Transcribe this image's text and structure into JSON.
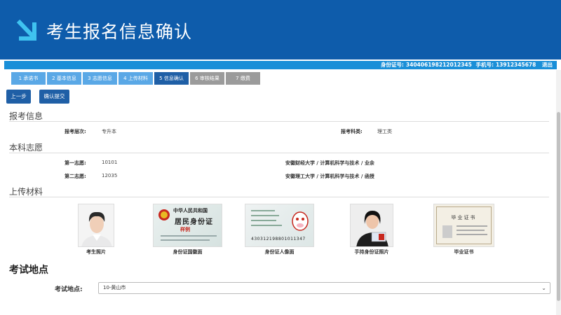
{
  "banner": {
    "title": "考生报名信息确认"
  },
  "infobar": {
    "id_label": "身份证号:",
    "id_value": "340406198212012345",
    "phone_label": "手机号:",
    "phone_value": "13912345678",
    "logout": "退出"
  },
  "steps": [
    {
      "label": "1 承诺书",
      "state": "done"
    },
    {
      "label": "2 基本信息",
      "state": "done"
    },
    {
      "label": "3 志愿信息",
      "state": "done"
    },
    {
      "label": "4 上传材料",
      "state": "done"
    },
    {
      "label": "5 信息确认",
      "state": "active"
    },
    {
      "label": "6 审核结果",
      "state": "todo"
    },
    {
      "label": "7 缴费",
      "state": "todo"
    }
  ],
  "buttons": {
    "prev": "上一步",
    "submit": "确认提交"
  },
  "exam_info": {
    "title": "报考信息",
    "level_label": "报考层次:",
    "level_value": "专升本",
    "subject_label": "报考科类:",
    "subject_value": "理工类"
  },
  "wishes": {
    "title": "本科志愿",
    "rows": [
      {
        "label": "第一志愿:",
        "code": "10101",
        "school": "安徽财经大学 / 计算机科学与技术 / 业余"
      },
      {
        "label": "第二志愿:",
        "code": "12035",
        "school": "安徽理工大学 / 计算机科学与技术 / 函授"
      }
    ]
  },
  "materials": {
    "title": "上传材料",
    "items": [
      {
        "caption": "考生照片"
      },
      {
        "caption": "身份证国徽面",
        "card_header": "中华人民共和国",
        "card_title": "居民身份证",
        "stamp": "样例"
      },
      {
        "caption": "身份证人像面",
        "id_number": "430312198801011347"
      },
      {
        "caption": "手持身份证照片"
      },
      {
        "caption": "毕业证书",
        "cert_title": "毕业证书"
      }
    ]
  },
  "exam_site": {
    "title": "考试地点",
    "label": "考试地点:",
    "selected": "10-黄山市"
  },
  "colors": {
    "banner": "#0e5cab",
    "infobar": "#1a8fd8",
    "step_active": "#1f5fa6",
    "step_done": "#5aa8e6",
    "step_todo": "#9b9b9b"
  }
}
